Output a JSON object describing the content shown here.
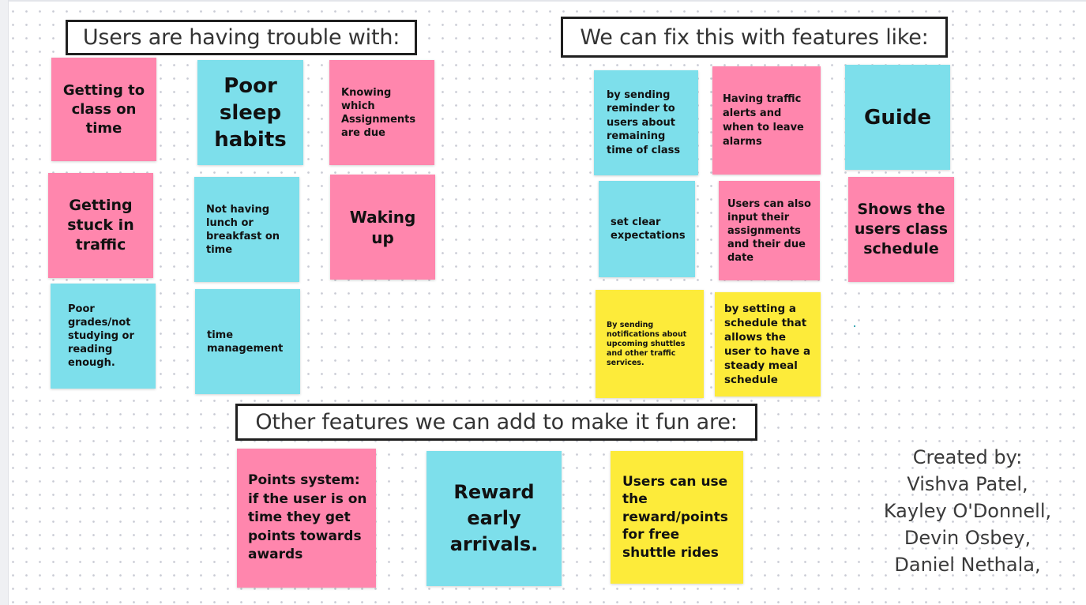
{
  "frames": {
    "trouble": "Users are having trouble with:",
    "features": "We can fix this with features like:",
    "fun": "Other features we can add to make it fun are:"
  },
  "trouble_notes": [
    "Getting to class on time",
    "Poor sleep habits",
    "Knowing which Assignments are due",
    "Getting stuck in traffic",
    "Not having lunch or breakfast on time",
    "Waking up",
    "Poor grades/not studying or reading enough.",
    "time management"
  ],
  "feature_notes": [
    "by sending reminder to users about remaining time of class",
    "Having traffic alerts and when to leave alarms",
    "Guide",
    "set clear expectations",
    "Users can also input their assignments and their due date",
    "Shows the users class schedule",
    "By sending notifications about upcoming shuttles and other traffic services.",
    "by setting a schedule that allows the user to have a steady meal schedule"
  ],
  "fun_notes": [
    "Points system: if the user is on time they get points towards awards",
    "Reward early arrivals.",
    "Users can use the reward/points for free shuttle rides"
  ],
  "credits": {
    "heading": "Created by:",
    "names": [
      "Vishva Patel,",
      "Kayley O'Donnell,",
      "Devin Osbey,",
      "Daniel Nethala,"
    ]
  },
  "colors": {
    "pink": "#ff86ad",
    "cyan": "#7ddfeb",
    "yellow": "#fdeb3a",
    "frame_border": "#1f1f1f"
  }
}
